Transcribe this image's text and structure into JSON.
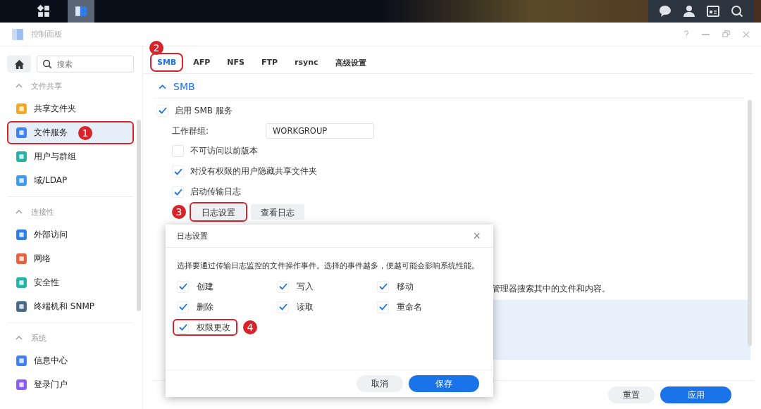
{
  "window": {
    "title": "控制面板"
  },
  "sidebar": {
    "search": {
      "placeholder": "搜索"
    },
    "sections": [
      {
        "title": "文件共享",
        "expanded": true,
        "items": [
          {
            "label": "共享文件夹",
            "selected": false
          },
          {
            "label": "文件服务",
            "selected": true,
            "annotation": "1"
          },
          {
            "label": "用户与群组",
            "selected": false
          },
          {
            "label": "域/LDAP",
            "selected": false
          }
        ]
      },
      {
        "title": "连接性",
        "expanded": true,
        "items": [
          {
            "label": "外部访问",
            "selected": false
          },
          {
            "label": "网络",
            "selected": false
          },
          {
            "label": "安全性",
            "selected": false
          },
          {
            "label": "终端机和 SNMP",
            "selected": false
          }
        ]
      },
      {
        "title": "系统",
        "expanded": true,
        "items": [
          {
            "label": "信息中心",
            "selected": false
          },
          {
            "label": "登录门户",
            "selected": false
          }
        ]
      }
    ]
  },
  "tabs": [
    {
      "label": "SMB",
      "selected": true,
      "annotation": "2"
    },
    {
      "label": "AFP",
      "selected": false
    },
    {
      "label": "NFS",
      "selected": false
    },
    {
      "label": "FTP",
      "selected": false
    },
    {
      "label": "rsync",
      "selected": false
    },
    {
      "label": "高级设置",
      "selected": false
    }
  ],
  "section": {
    "title": "SMB",
    "expanded": true
  },
  "settings": [
    {
      "kind": "checkbox",
      "label": "启用 SMB 服务",
      "checked": true,
      "indent": false
    },
    {
      "kind": "field",
      "label": "工作群组:",
      "value": "WORKGROUP"
    },
    {
      "kind": "checkbox",
      "label": "不可访问以前版本",
      "checked": false,
      "indent": true
    },
    {
      "kind": "checkbox",
      "label": "对没有权限的用户隐藏共享文件夹",
      "checked": true,
      "indent": true
    },
    {
      "kind": "checkbox",
      "label": "启动传输日志",
      "checked": true,
      "indent": true
    },
    {
      "kind": "buttons",
      "buttons": [
        {
          "label": "日志设置",
          "annotation": "3"
        },
        {
          "label": "查看日志"
        }
      ]
    }
  ],
  "partial_text": "管理器搜索其中的文件和内容。",
  "footer_buttons": [
    {
      "label": "重置",
      "primary": false
    },
    {
      "label": "应用",
      "primary": true
    }
  ],
  "dialog": {
    "title": "日志设置",
    "close": "×",
    "description": "选择要通过传输日志监控的文件操作事件。选择的事件越多，便越可能会影响系统性能。",
    "options": [
      {
        "label": "创建",
        "checked": true
      },
      {
        "label": "写入",
        "checked": true
      },
      {
        "label": "移动",
        "checked": true
      },
      {
        "label": "删除",
        "checked": true
      },
      {
        "label": "读取",
        "checked": true
      },
      {
        "label": "重命名",
        "checked": true
      },
      {
        "label": "权限更改",
        "checked": true,
        "annotation": "4"
      }
    ],
    "buttons": [
      {
        "label": "取消",
        "primary": false
      },
      {
        "label": "保存",
        "primary": true
      }
    ]
  }
}
